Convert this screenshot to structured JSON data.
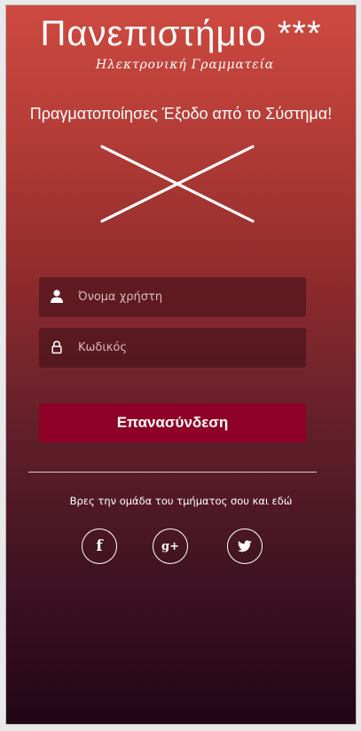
{
  "header": {
    "title": "Πανεπιστήμιο ***",
    "subtitle": "Ηλεκτρονική Γραμματεία"
  },
  "status": {
    "message": "Πραγματοποίησες Έξοδο από το Σύστημα!"
  },
  "login_form": {
    "username_placeholder": "Όνομα χρήστη",
    "password_placeholder": "Κωδικός",
    "submit_label": "Επανασύνδεση"
  },
  "footer": {
    "group_text": "Βρες την ομάδα του τμήματος σου και εδώ",
    "social": [
      {
        "name": "facebook",
        "glyph": "f",
        "icon": "facebook-icon"
      },
      {
        "name": "google-plus",
        "glyph": "g+",
        "icon": "google-plus-icon"
      },
      {
        "name": "twitter",
        "glyph": "",
        "icon": "twitter-icon"
      }
    ]
  },
  "colors": {
    "gradient_top": "#cd4a40",
    "gradient_bottom": "#220616",
    "button": "#8e0027",
    "text": "#ffffff"
  }
}
